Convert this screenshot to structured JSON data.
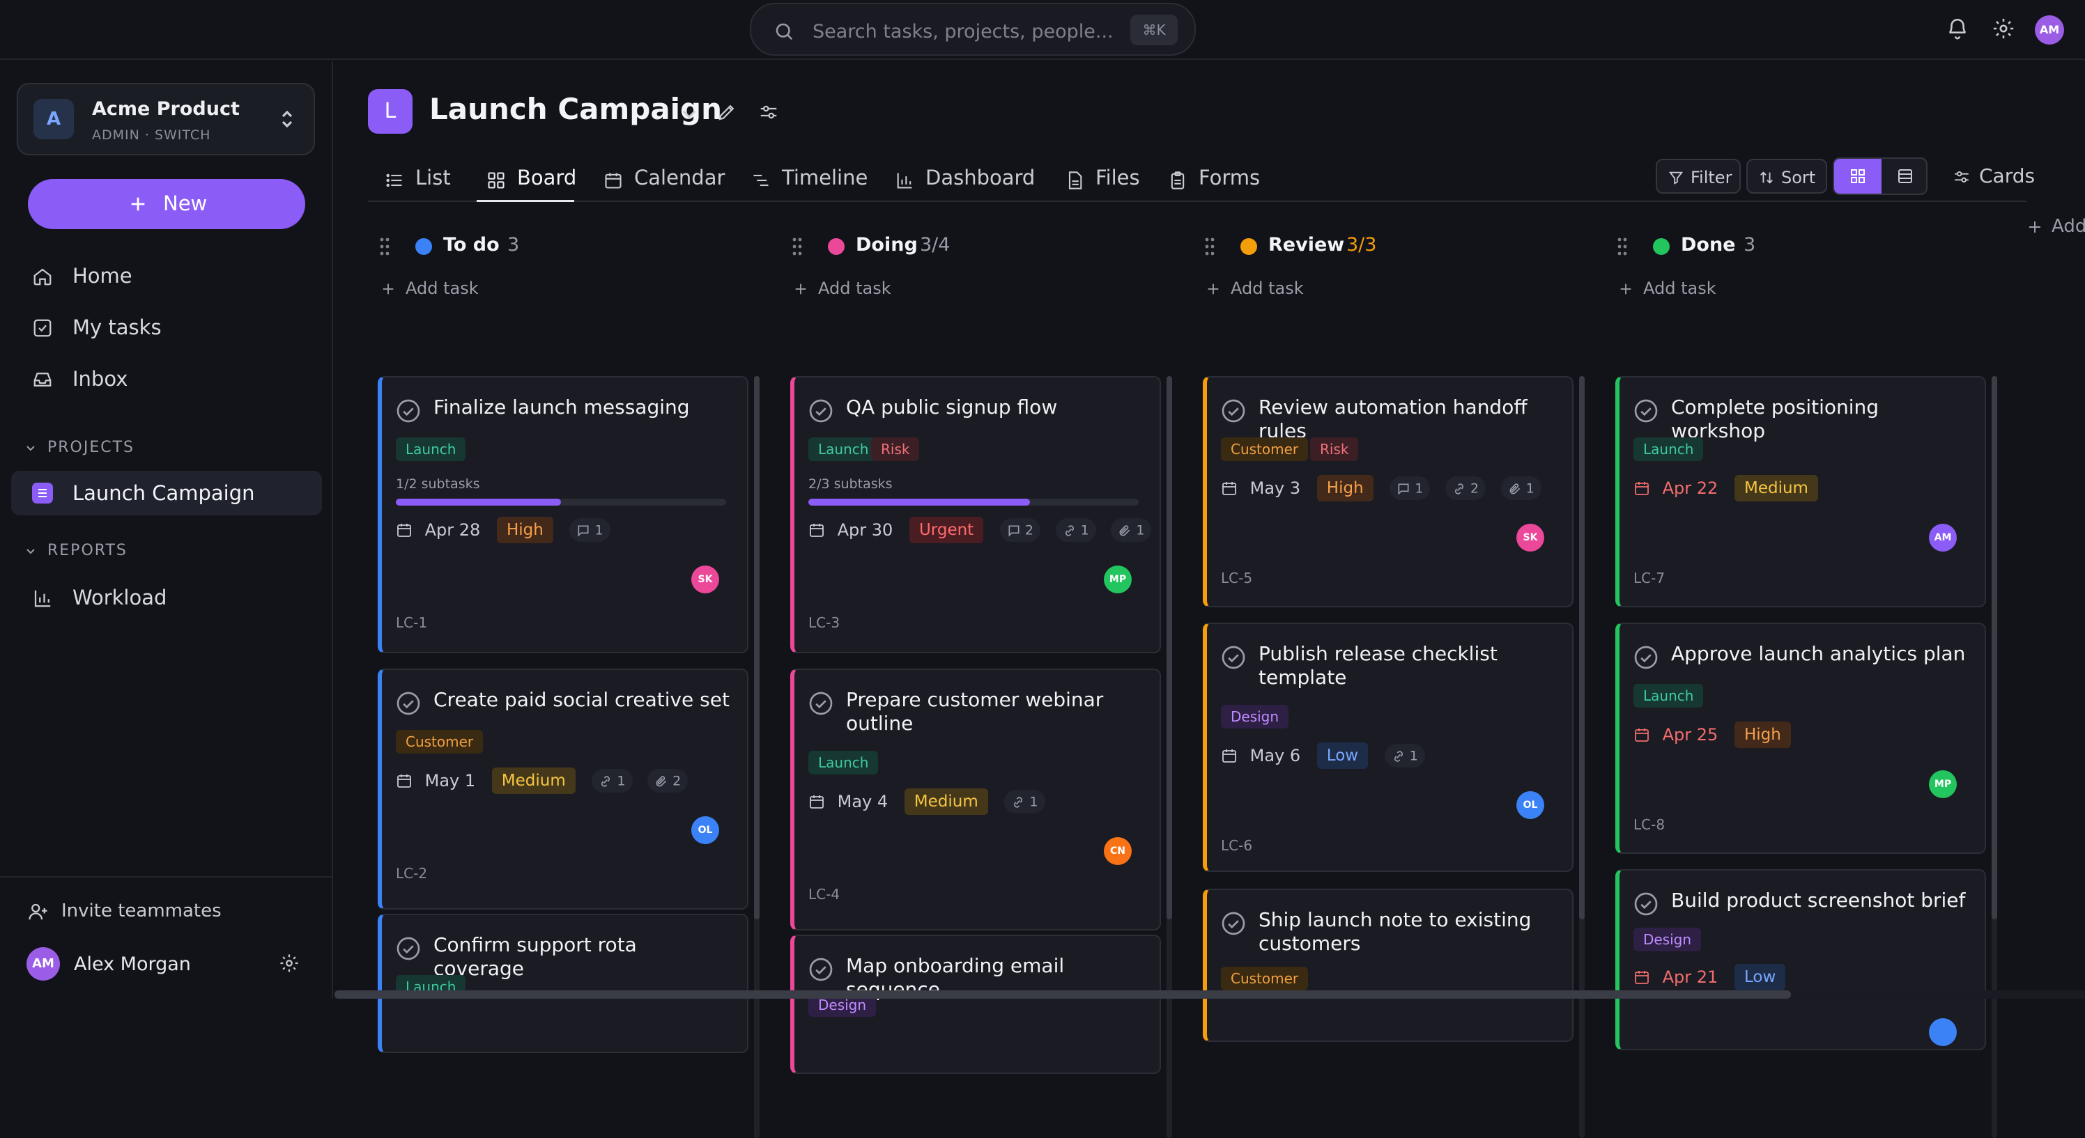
{
  "search": {
    "placeholder": "Search tasks, projects, people...",
    "shortcut": "⌘K"
  },
  "topbar": {
    "user_initials": "AM"
  },
  "workspace": {
    "initial": "A",
    "name": "Acme Product",
    "role": "ADMIN · SWITCH"
  },
  "sidebar": {
    "new_label": "New",
    "nav": [
      {
        "label": "Home"
      },
      {
        "label": "My tasks"
      },
      {
        "label": "Inbox"
      }
    ],
    "projects_heading": "PROJECTS",
    "projects": [
      {
        "label": "Launch Campaign"
      }
    ],
    "reports_heading": "REPORTS",
    "reports": [
      {
        "label": "Workload"
      }
    ],
    "invite_label": "Invite teammates",
    "user": {
      "initials": "AM",
      "name": "Alex Morgan"
    }
  },
  "project": {
    "initial": "L",
    "title": "Launch Campaign"
  },
  "tabs": [
    {
      "label": "List"
    },
    {
      "label": "Board"
    },
    {
      "label": "Calendar"
    },
    {
      "label": "Timeline"
    },
    {
      "label": "Dashboard"
    },
    {
      "label": "Files"
    },
    {
      "label": "Forms"
    }
  ],
  "toolbar": {
    "filter": "Filter",
    "sort": "Sort",
    "cards": "Cards",
    "add_column": "Add"
  },
  "add_task_label": "Add task",
  "colors": {
    "accent": "#8b5cf6",
    "todo": "#3b82f6",
    "doing": "#ec4899",
    "review": "#f59e0b",
    "done": "#22c55e"
  },
  "columns": [
    {
      "name": "To do",
      "count": "3",
      "cards": [
        {
          "title": "Finalize launch messaging",
          "tags": [
            "Launch"
          ],
          "subtasks": "1/2 subtasks",
          "progress": 0.5,
          "date": "Apr 28",
          "priority": "High",
          "comments": "1",
          "assignee": "SK",
          "id": "LC-1"
        },
        {
          "title": "Create paid social creative set",
          "tags": [
            "Customer"
          ],
          "date": "May 1",
          "priority": "Medium",
          "links": "1",
          "attachments": "2",
          "assignee": "OL",
          "id": "LC-2"
        },
        {
          "title": "Confirm support rota coverage",
          "tags": [
            "Launch"
          ]
        }
      ]
    },
    {
      "name": "Doing",
      "count": "3/4",
      "cards": [
        {
          "title": "QA public signup flow",
          "tags": [
            "Launch",
            "Risk"
          ],
          "subtasks": "2/3 subtasks",
          "progress": 0.67,
          "date": "Apr 30",
          "priority": "Urgent",
          "comments": "2",
          "links": "1",
          "attachments": "1",
          "assignee": "MP",
          "id": "LC-3"
        },
        {
          "title": "Prepare customer webinar outline",
          "tags": [
            "Launch"
          ],
          "date": "May 4",
          "priority": "Medium",
          "links": "1",
          "assignee": "CN",
          "id": "LC-4"
        },
        {
          "title": "Map onboarding email sequence",
          "tags": [
            "Design"
          ]
        }
      ]
    },
    {
      "name": "Review",
      "count": "3/3",
      "cards": [
        {
          "title": "Review automation handoff rules",
          "tags": [
            "Customer",
            "Risk"
          ],
          "date": "May 3",
          "priority": "High",
          "comments": "1",
          "links": "2",
          "attachments": "1",
          "assignee": "SK",
          "id": "LC-5"
        },
        {
          "title": "Publish release checklist template",
          "tags": [
            "Design"
          ],
          "date": "May 6",
          "priority": "Low",
          "links": "1",
          "assignee": "OL",
          "id": "LC-6"
        },
        {
          "title": "Ship launch note to existing customers",
          "tags": [
            "Customer"
          ]
        }
      ]
    },
    {
      "name": "Done",
      "count": "3",
      "cards": [
        {
          "title": "Complete positioning workshop",
          "tags": [
            "Launch"
          ],
          "date": "Apr 22",
          "priority": "Medium",
          "assignee": "AM",
          "id": "LC-7"
        },
        {
          "title": "Approve launch analytics plan",
          "tags": [
            "Launch"
          ],
          "date": "Apr 25",
          "priority": "High",
          "assignee": "MP",
          "id": "LC-8"
        },
        {
          "title": "Build product screenshot brief",
          "tags": [
            "Design"
          ],
          "date": "Apr 21",
          "priority": "Low"
        }
      ]
    }
  ]
}
